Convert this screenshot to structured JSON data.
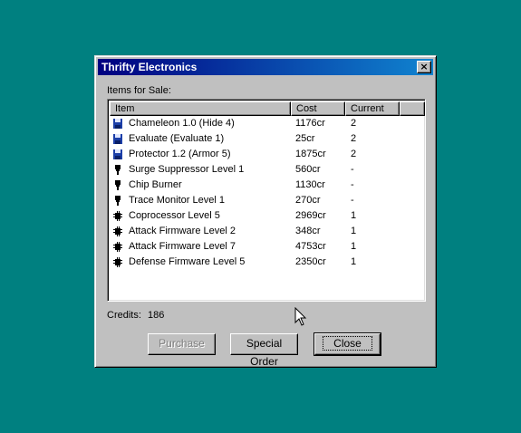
{
  "window": {
    "title": "Thrifty Electronics",
    "close_glyph": "×"
  },
  "list_label": "Items for Sale:",
  "columns": [
    "Item",
    "Cost",
    "Current"
  ],
  "items": [
    {
      "icon": "floppy-disk-icon",
      "name": "Chameleon 1.0 (Hide 4)",
      "cost": "1176cr",
      "current": "2"
    },
    {
      "icon": "floppy-disk-icon",
      "name": "Evaluate (Evaluate 1)",
      "cost": "25cr",
      "current": "2"
    },
    {
      "icon": "floppy-disk-icon",
      "name": "Protector 1.2 (Armor 5)",
      "cost": "1875cr",
      "current": "2"
    },
    {
      "icon": "hardware-plug-icon",
      "name": "Surge Suppressor Level 1",
      "cost": "560cr",
      "current": "-"
    },
    {
      "icon": "hardware-plug-icon",
      "name": "Chip Burner",
      "cost": "1130cr",
      "current": "-"
    },
    {
      "icon": "hardware-plug-icon",
      "name": "Trace Monitor Level 1",
      "cost": "270cr",
      "current": "-"
    },
    {
      "icon": "microchip-icon",
      "name": "Coprocessor  Level 5",
      "cost": "2969cr",
      "current": "1"
    },
    {
      "icon": "microchip-icon",
      "name": "Attack Firmware  Level 2",
      "cost": "348cr",
      "current": "1"
    },
    {
      "icon": "microchip-icon",
      "name": "Attack Firmware  Level 7",
      "cost": "4753cr",
      "current": "1"
    },
    {
      "icon": "microchip-icon",
      "name": "Defense Firmware  Level 5",
      "cost": "2350cr",
      "current": "1"
    }
  ],
  "credits": {
    "label": "Credits:",
    "value": "186"
  },
  "buttons": {
    "purchase": "Purchase",
    "special_order": "Special Order",
    "close": "Close"
  },
  "colors": {
    "desktop": "#008080",
    "titlebar": "#000080",
    "face": "#c0c0c0",
    "floppy": "#1c3fa8",
    "disabled_text": "#808080"
  }
}
